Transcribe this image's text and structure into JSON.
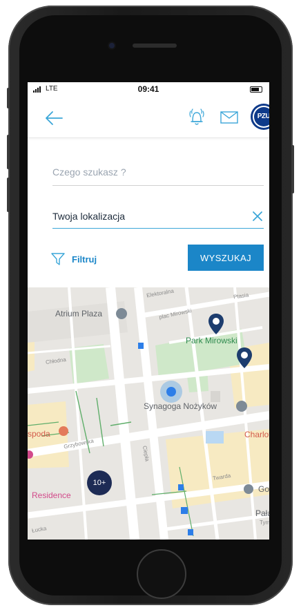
{
  "status_bar": {
    "carrier": "LTE",
    "time": "09:41"
  },
  "header": {
    "back_icon": "arrow-left-icon",
    "bell_icon": "bell-icon",
    "mail_icon": "mail-icon",
    "logo_text": "PZU"
  },
  "search": {
    "what_placeholder": "Czego szukasz ?",
    "location_value": "Twoja lokalizacja",
    "clear_icon": "close-icon",
    "filter_label": "Filtruj",
    "filter_icon": "filter-icon",
    "search_button": "WYSZUKAJ"
  },
  "map": {
    "places": {
      "atrium": "Atrium Plaza",
      "park": "Park Mirowski",
      "synagoga": "Synagoga Nożyków",
      "charlotte": "Charlotte",
      "residence": "Residence",
      "poda": "spoda",
      "google": "Googl",
      "palac": "Pałac",
      "tymc": "Tymc"
    },
    "streets": {
      "elektoralna": "Elektoralna",
      "plac_mirowski": "plac Mirowski",
      "plasia": "Ptasia",
      "chlodna": "Chłodna",
      "grzybowska": "Grzybowska",
      "ciepla": "Ciepła",
      "twarda": "Twarda",
      "lucka": "Łucka"
    },
    "cluster_label": "10+"
  },
  "colors": {
    "accent": "#1b86c8",
    "brand": "#0e3a8a",
    "cluster": "#1d2b55"
  }
}
